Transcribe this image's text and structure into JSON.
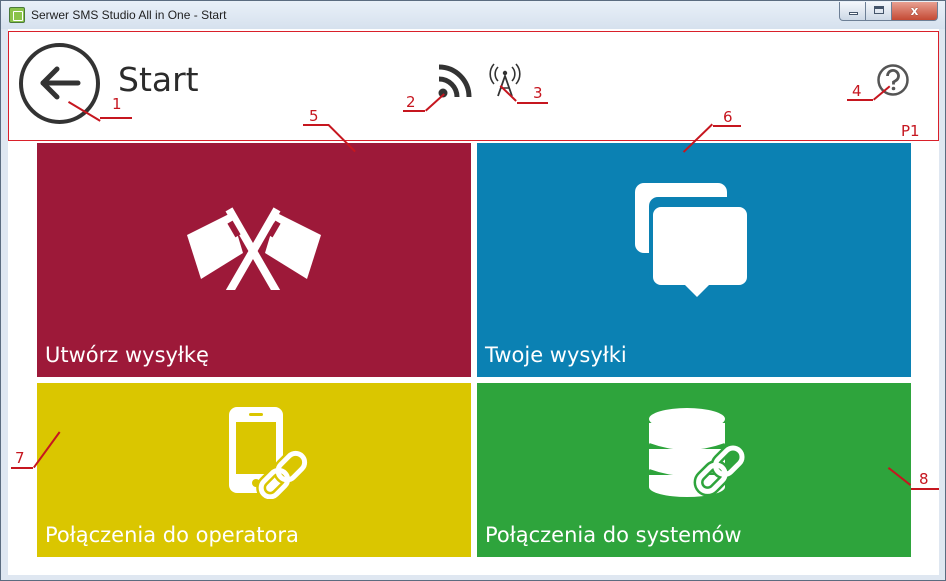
{
  "window": {
    "title": "Serwer SMS Studio All in One - Start",
    "close_glyph": "x"
  },
  "header": {
    "title": "Start",
    "panel_label": "P1"
  },
  "icons": {
    "back": "back-arrow-icon",
    "signal": "rss-signal-icon",
    "antenna": "antenna-icon",
    "help": "help-icon"
  },
  "tiles": [
    {
      "label": "Utwórz wysyłkę",
      "icon": "crossed-flags-icon",
      "color": "#9d1939"
    },
    {
      "label": "Twoje wysyłki",
      "icon": "chat-bubbles-icon",
      "color": "#0b81b3"
    },
    {
      "label": "Połączenia do operatora",
      "icon": "phone-link-icon",
      "color": "#dac600"
    },
    {
      "label": "Połączenia do systemów",
      "icon": "database-link-icon",
      "color": "#2ea43c"
    }
  ],
  "callouts": [
    "1",
    "2",
    "3",
    "4",
    "5",
    "6",
    "7",
    "8"
  ],
  "colors": {
    "annotation": "#c6161f"
  }
}
